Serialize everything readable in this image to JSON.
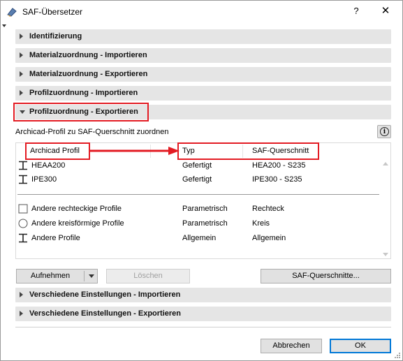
{
  "window": {
    "title": "SAF-Übersetzer",
    "help_label": "?",
    "close_label": "✕"
  },
  "sections_top": [
    {
      "label": "Identifizierung",
      "expanded": false
    },
    {
      "label": "Materialzuordnung - Importieren",
      "expanded": false
    },
    {
      "label": "Materialzuordnung - Exportieren",
      "expanded": false
    },
    {
      "label": "Profilzuordnung - Importieren",
      "expanded": false
    },
    {
      "label": "Profilzuordnung - Exportieren",
      "expanded": true
    }
  ],
  "panel": {
    "subtitle": "Archicad-Profil zu SAF-Querschnitt zuordnen",
    "info_label": "i"
  },
  "table": {
    "headers": [
      "Archicad Profil",
      "Typ",
      "SAF-Querschnitt"
    ],
    "rows": [
      {
        "icon": "i-beam-icon",
        "profile": "HEAA200",
        "type": "Gefertigt",
        "section": "HEA200 - S235"
      },
      {
        "icon": "i-beam-icon",
        "profile": "IPE300",
        "type": "Gefertigt",
        "section": "IPE300 - S235"
      }
    ],
    "default_rows": [
      {
        "icon": "rectangle-icon",
        "profile": "Andere rechteckige Profile",
        "type": "Parametrisch",
        "section": "Rechteck"
      },
      {
        "icon": "circle-icon",
        "profile": "Andere kreisförmige Profile",
        "type": "Parametrisch",
        "section": "Kreis"
      },
      {
        "icon": "i-beam-icon",
        "profile": "Andere Profile",
        "type": "Allgemein",
        "section": "Allgemein"
      }
    ]
  },
  "buttons": {
    "add": "Aufnehmen",
    "delete": "Löschen",
    "saf_sections": "SAF-Querschnitte...",
    "cancel": "Abbrechen",
    "ok": "OK"
  },
  "sections_bottom": [
    {
      "label": "Verschiedene Einstellungen - Importieren",
      "expanded": false
    },
    {
      "label": "Verschiedene Einstellungen - Exportieren",
      "expanded": false
    }
  ],
  "colors": {
    "highlight": "#e31b23",
    "section_bg": "#e5e5e5",
    "primary_border": "#0078d7"
  }
}
